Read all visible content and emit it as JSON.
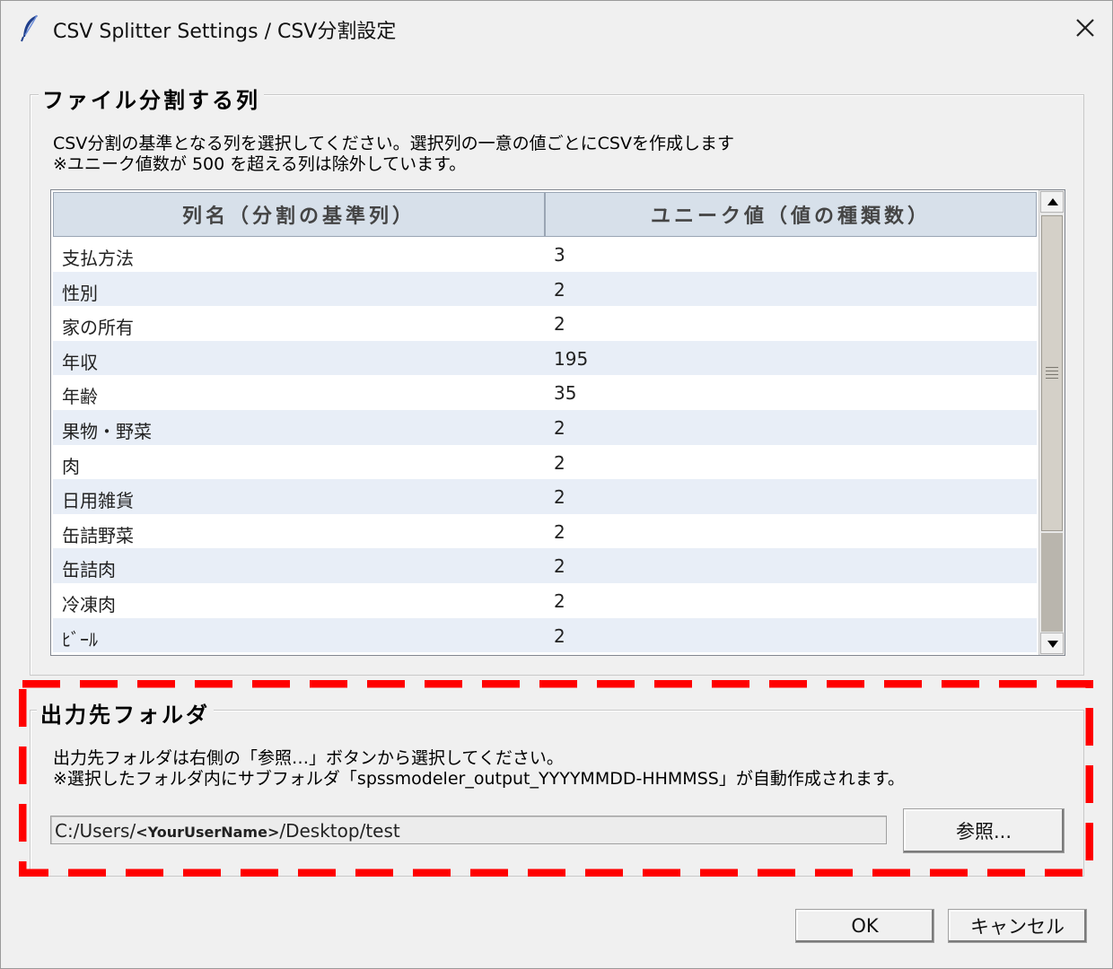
{
  "window": {
    "title": "CSV Splitter Settings / CSV分割設定",
    "icon": "feather-icon",
    "close_icon": "close-icon"
  },
  "split_column_group": {
    "label": "ファイル分割する列",
    "description_line1": "CSV分割の基準となる列を選択してください。選択列の一意の値ごとにCSVを作成します",
    "description_line2": "※ユニーク値数が 500 を超える列は除外しています。",
    "table": {
      "headers": [
        "列名（分割の基準列）",
        "ユニーク値（値の種類数）"
      ],
      "rows": [
        {
          "name": "支払方法",
          "count": "3"
        },
        {
          "name": "性別",
          "count": "2"
        },
        {
          "name": "家の所有",
          "count": "2"
        },
        {
          "name": "年収",
          "count": "195"
        },
        {
          "name": "年齢",
          "count": "35"
        },
        {
          "name": "果物・野菜",
          "count": "2"
        },
        {
          "name": "肉",
          "count": "2"
        },
        {
          "name": "日用雑貨",
          "count": "2"
        },
        {
          "name": "缶詰野菜",
          "count": "2"
        },
        {
          "name": "缶詰肉",
          "count": "2"
        },
        {
          "name": "冷凍肉",
          "count": "2"
        },
        {
          "name": "ﾋﾞｰﾙ",
          "count": "2"
        }
      ]
    }
  },
  "output_group": {
    "label": "出力先フォルダ",
    "description_line1": "出力先フォルダは右側の「参照…」ボタンから選択してください。",
    "description_line2": "※選択したフォルダ内にサブフォルダ「spssmodeler_output_YYYYMMDD-HHMMSS」が自動作成されます。",
    "path_prefix": "C:/Users/",
    "path_user": "<YourUserName>",
    "path_suffix": "/Desktop/test",
    "browse_label": "参照..."
  },
  "buttons": {
    "ok_label": "OK",
    "cancel_label": "キャンセル"
  },
  "annotation": {
    "highlight_color": "#ff0000"
  }
}
